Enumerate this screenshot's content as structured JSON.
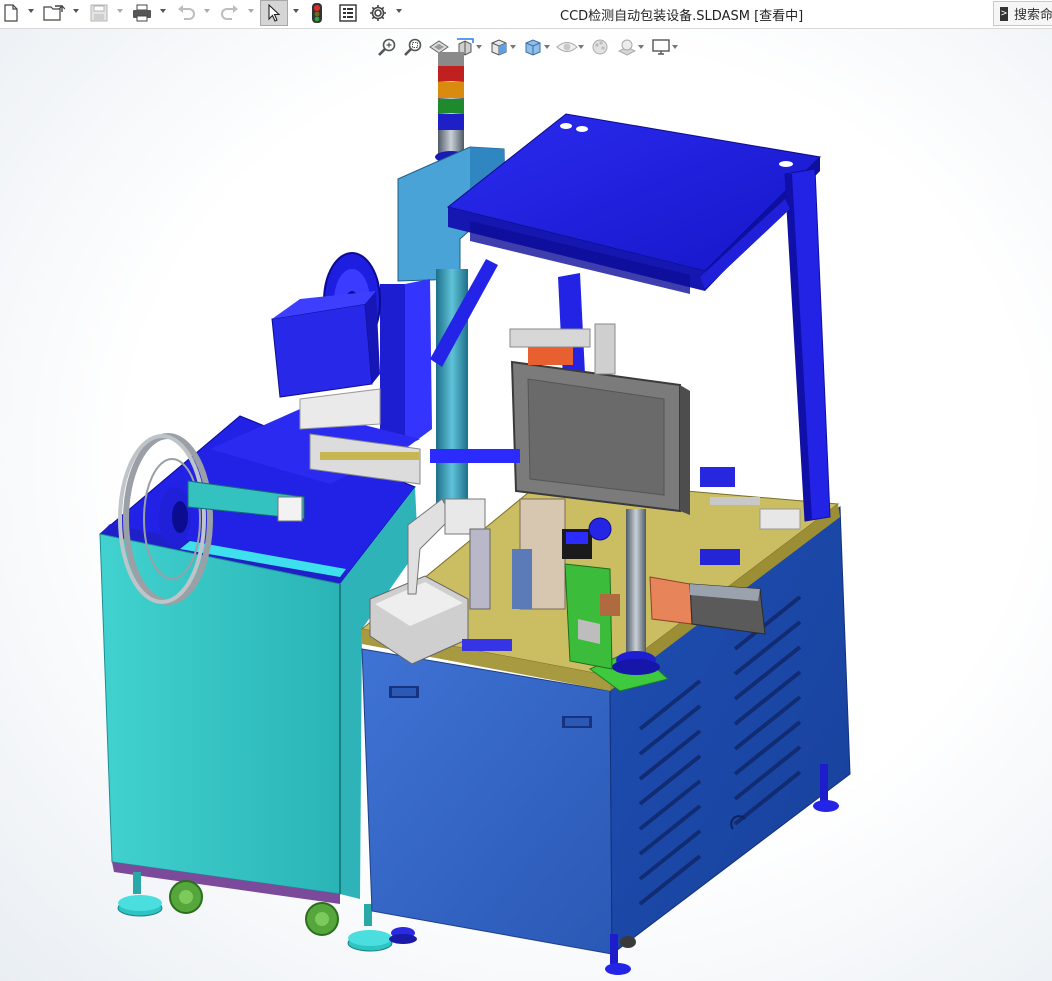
{
  "window": {
    "title": "CCD检测自动包装设备.SLDASM [查看中]"
  },
  "search": {
    "label": "搜索命"
  },
  "toolbar": {
    "items": [
      {
        "icon": "new-document-icon"
      },
      {
        "icon": "open-folder-icon"
      },
      {
        "icon": "save-icon"
      },
      {
        "icon": "print-icon"
      },
      {
        "icon": "undo-icon"
      },
      {
        "icon": "redo-icon"
      },
      {
        "icon": "select-arrow-icon"
      },
      {
        "icon": "traffic-light-icon"
      },
      {
        "icon": "file-properties-icon"
      },
      {
        "icon": "options-gear-icon"
      }
    ]
  },
  "headsup_toolbar": {
    "items": [
      {
        "icon": "zoom-to-fit-icon"
      },
      {
        "icon": "zoom-to-area-icon"
      },
      {
        "icon": "previous-view-icon"
      },
      {
        "icon": "section-view-icon"
      },
      {
        "icon": "view-orientation-icon"
      },
      {
        "icon": "display-style-icon"
      },
      {
        "icon": "hide-show-items-icon"
      },
      {
        "icon": "edit-appearance-icon"
      },
      {
        "icon": "apply-scene-icon"
      },
      {
        "icon": "view-settings-icon"
      }
    ]
  },
  "colors": {
    "frame_blue": "#1f1fe0",
    "cabinet_cyan": "#34c2c0",
    "cabinet_steel": "#2e5fc8",
    "deck_khaki": "#c7b85c",
    "monitor_gray": "#7a7a7a"
  }
}
